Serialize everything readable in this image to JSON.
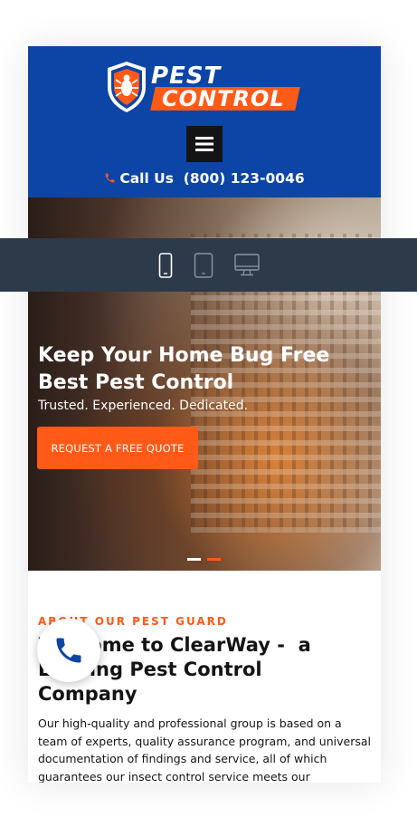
{
  "header": {
    "logo_top": "PEST",
    "logo_bottom": "CONTROL",
    "call_label": "Call Us",
    "phone": "(800) 123-0046"
  },
  "hero": {
    "title_line1": "Keep Your Home Bug Free",
    "title_line2": "Best Pest Control",
    "subtitle": "Trusted. Experienced. Dedicated.",
    "cta_label": "REQUEST A FREE QUOTE",
    "slides": 2,
    "active_slide": 1
  },
  "about": {
    "kicker": "ABOUT OUR PEST GUARD",
    "title_line1": "Welcome to ClearWay -  a",
    "title_line2": "Leading Pest Control",
    "title_line3": "Company",
    "body": "Our high-quality and professional group is based on a team of experts, quality assurance program, and universal documentation of findings and service, all of which guarantees our insect control service meets our"
  },
  "device_bar": {
    "devices": [
      "mobile",
      "tablet",
      "desktop"
    ],
    "selected": "mobile"
  },
  "colors": {
    "brand_blue": "#0c45a6",
    "accent_orange": "#ff5a17",
    "device_bar": "#2c3a4a"
  },
  "icons": [
    "shield-bug-logo-icon",
    "hamburger-menu-icon",
    "phone-icon",
    "mobile-icon",
    "tablet-icon",
    "desktop-icon",
    "floating-phone-icon"
  ]
}
